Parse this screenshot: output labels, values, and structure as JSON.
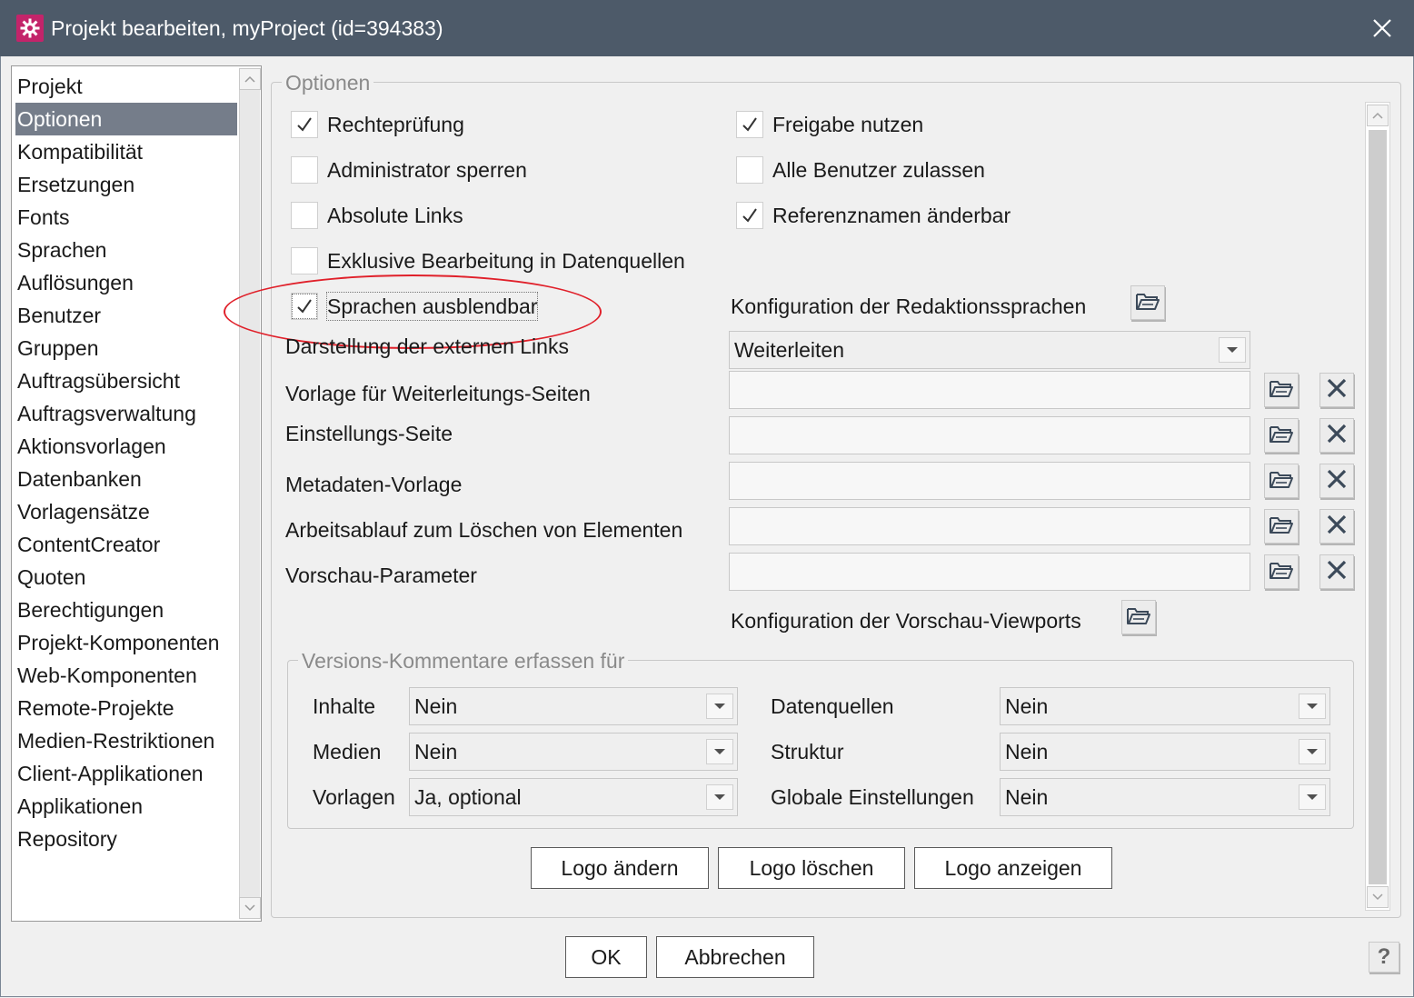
{
  "window": {
    "title": "Projekt bearbeiten, myProject (id=394383)",
    "app_icon": "gear-icon",
    "close_icon": "close-icon"
  },
  "nav": {
    "items": [
      "Projekt",
      "Optionen",
      "Kompatibilität",
      "Ersetzungen",
      "Fonts",
      "Sprachen",
      "Auflösungen",
      "Benutzer",
      "Gruppen",
      "Auftragsübersicht",
      "Auftragsverwaltung",
      "Aktionsvorlagen",
      "Datenbanken",
      "Vorlagensätze",
      "ContentCreator",
      "Quoten",
      "Berechtigungen",
      "Projekt-Komponenten",
      "Web-Komponenten",
      "Remote-Projekte",
      "Medien-Restriktionen",
      "Client-Applikationen",
      "Applikationen",
      "Repository"
    ],
    "selected": "Optionen"
  },
  "options": {
    "legend": "Optionen",
    "checkboxes": {
      "rechtepruefung": {
        "label": "Rechteprüfung",
        "checked": true
      },
      "freigabe": {
        "label": "Freigabe nutzen",
        "checked": true
      },
      "admin_sperren": {
        "label": "Administrator sperren",
        "checked": false
      },
      "alle_benutzer": {
        "label": "Alle Benutzer zulassen",
        "checked": false
      },
      "absolute_links": {
        "label": "Absolute Links",
        "checked": false
      },
      "referenznamen": {
        "label": "Referenznamen änderbar",
        "checked": true
      },
      "exklusiv": {
        "label": "Exklusive Bearbeitung in Datenquellen",
        "checked": false
      },
      "sprachen_ausblendbar": {
        "label": "Sprachen ausblendbar",
        "checked": true
      }
    },
    "konfig_redaktionssprachen": "Konfiguration der Redaktionssprachen",
    "darstellung_label": "Darstellung der externen Links",
    "darstellung_value": "Weiterleiten",
    "fields": {
      "vorlage_weiterleitung": "Vorlage für Weiterleitungs-Seiten",
      "einstellungs_seite": "Einstellungs-Seite",
      "metadaten_vorlage": "Metadaten-Vorlage",
      "arbeitsablauf": "Arbeitsablauf zum Löschen von Elementen",
      "vorschau_parameter": "Vorschau-Parameter"
    },
    "konfig_viewports": "Konfiguration der Vorschau-Viewports"
  },
  "versions": {
    "legend": "Versions-Kommentare erfassen für",
    "inhalte": {
      "label": "Inhalte",
      "value": "Nein"
    },
    "medien": {
      "label": "Medien",
      "value": "Nein"
    },
    "vorlagen": {
      "label": "Vorlagen",
      "value": "Ja, optional"
    },
    "datenquellen": {
      "label": "Datenquellen",
      "value": "Nein"
    },
    "struktur": {
      "label": "Struktur",
      "value": "Nein"
    },
    "globale": {
      "label": "Globale Einstellungen",
      "value": "Nein"
    }
  },
  "logo_buttons": {
    "aendern": "Logo ändern",
    "loeschen": "Logo löschen",
    "anzeigen": "Logo anzeigen"
  },
  "footer": {
    "ok": "OK",
    "abbrechen": "Abbrechen",
    "help": "?"
  },
  "colors": {
    "titlebar": "#4d5a69",
    "selection": "#757d8a",
    "highlight": "#e0202a"
  }
}
